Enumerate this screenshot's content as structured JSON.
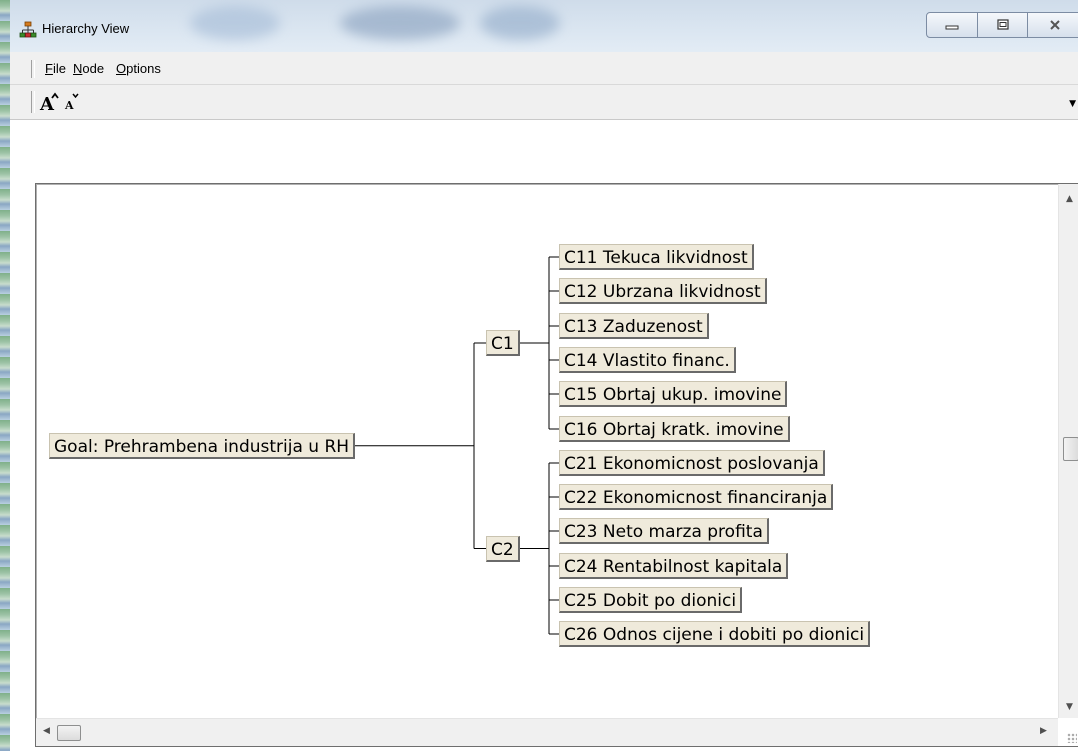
{
  "window": {
    "title": "Hierarchy View"
  },
  "menu": [
    {
      "label": "File",
      "mnemonic": "F",
      "rest": "ile"
    },
    {
      "label": "Node",
      "mnemonic": "N",
      "rest": "ode"
    },
    {
      "label": "Options",
      "mnemonic": "O",
      "rest": "ptions"
    }
  ],
  "toolbar": {
    "icons": [
      "increase-font-icon",
      "decrease-font-icon"
    ]
  },
  "hierarchy": {
    "goal": "Goal: Prehrambena industrija u  RH",
    "groups": [
      {
        "label": "C1",
        "children": [
          "C11 Tekuca likvidnost",
          "C12 Ubrzana likvidnost",
          "C13 Zaduzenost",
          "C14 Vlastito financ.",
          "C15 Obrtaj ukup. imovine",
          "C16 Obrtaj kratk. imovine"
        ]
      },
      {
        "label": "C2",
        "children": [
          "C21 Ekonomicnost poslovanja",
          "C22 Ekonomicnost financiranja",
          "C23 Neto marza profita",
          "C24 Rentabilnost kapitala",
          "C25 Dobit po dionici",
          "C26 Odnos cijene i dobiti po dionici"
        ]
      }
    ]
  }
}
